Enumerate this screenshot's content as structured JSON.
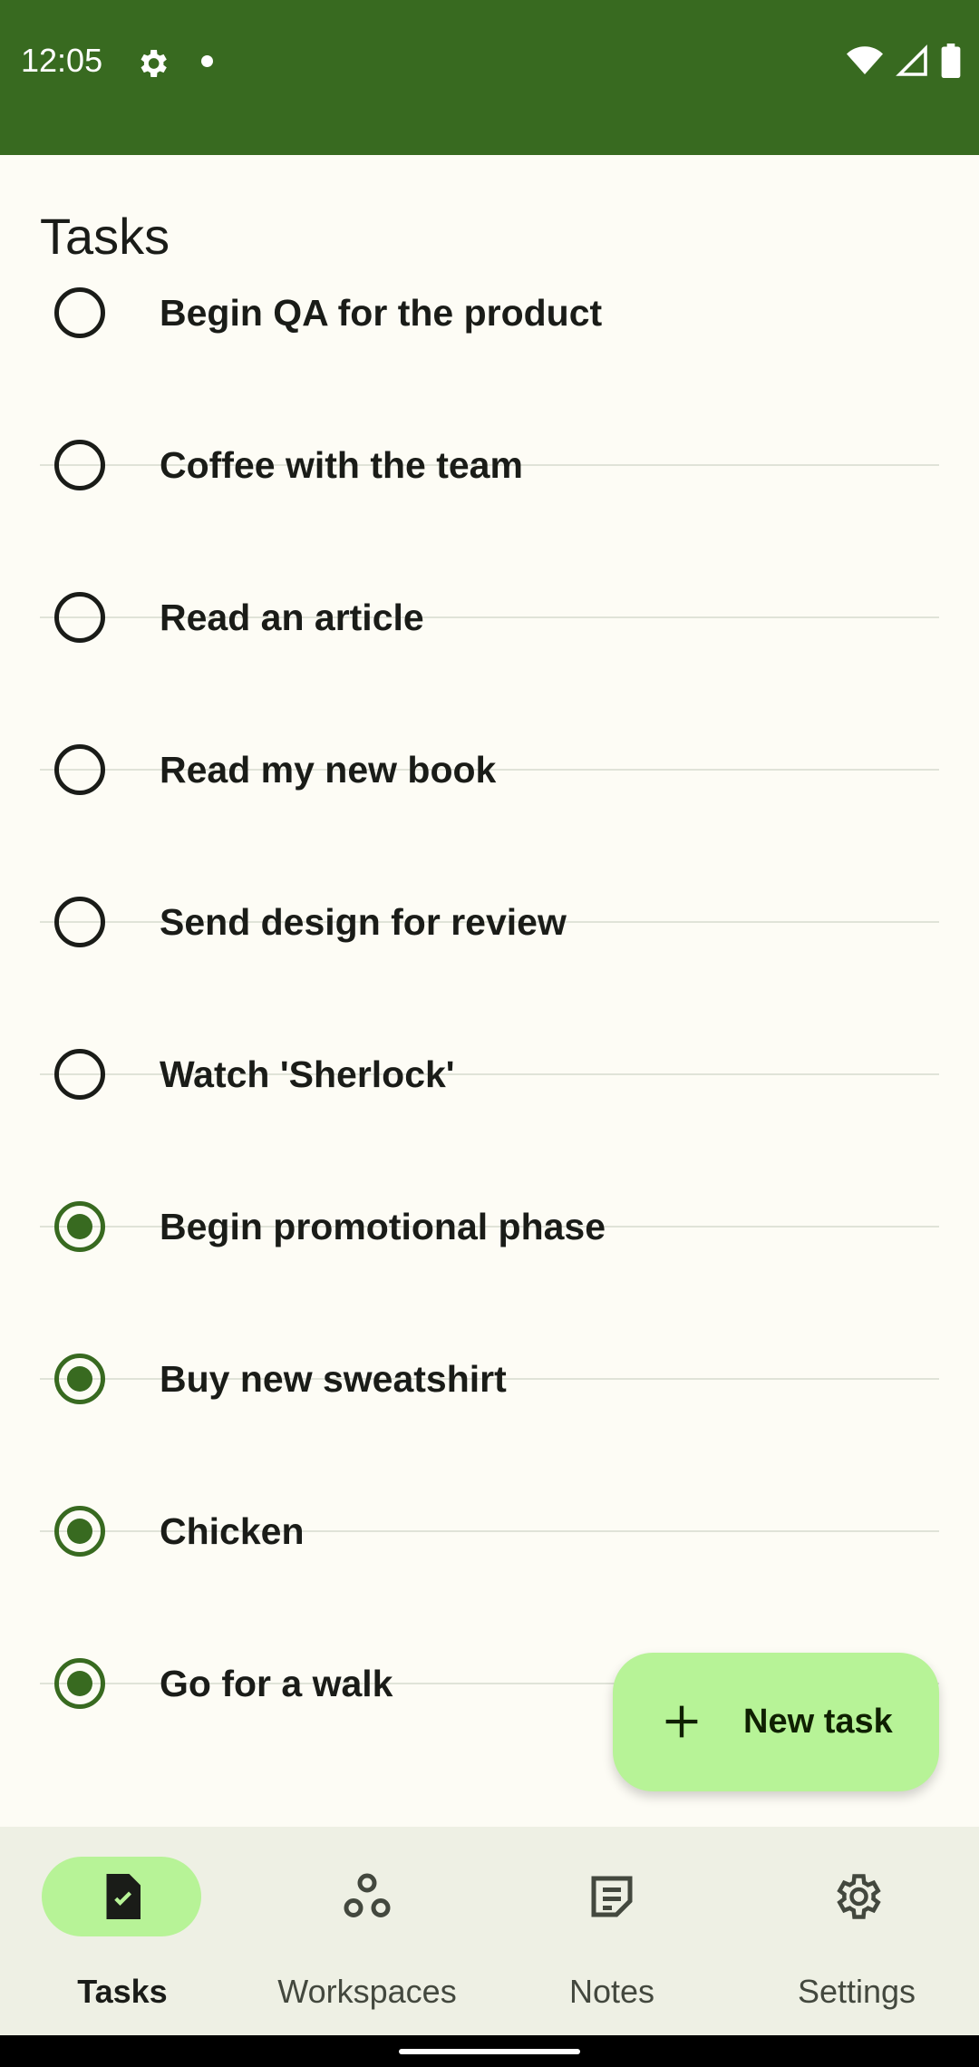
{
  "status_bar": {
    "time": "12:05",
    "icons": [
      "gear-icon",
      "notification-dot-icon",
      "wifi-icon",
      "signal-icon",
      "battery-icon"
    ]
  },
  "page": {
    "title": "Tasks"
  },
  "tasks": [
    {
      "label": "Begin QA for the product",
      "done": false
    },
    {
      "label": "Coffee with the team",
      "done": false
    },
    {
      "label": "Read an article",
      "done": false
    },
    {
      "label": "Read my new book",
      "done": false
    },
    {
      "label": "Send design for review",
      "done": false
    },
    {
      "label": "Watch 'Sherlock'",
      "done": false
    },
    {
      "label": "Begin promotional phase",
      "done": true
    },
    {
      "label": "Buy new sweatshirt",
      "done": true
    },
    {
      "label": "Chicken",
      "done": true
    },
    {
      "label": "Go for a walk",
      "done": true
    }
  ],
  "fab": {
    "label": "New task",
    "icon": "plus-icon"
  },
  "nav": {
    "items": [
      {
        "label": "Tasks",
        "icon": "task-check-icon",
        "active": true
      },
      {
        "label": "Workspaces",
        "icon": "workspaces-icon",
        "active": false
      },
      {
        "label": "Notes",
        "icon": "notes-icon",
        "active": false
      },
      {
        "label": "Settings",
        "icon": "gear-icon",
        "active": false
      }
    ]
  },
  "colors": {
    "primary": "#386a20",
    "primary_container": "#b7f397",
    "background": "#fdfcf5",
    "nav_background": "#eef0e4"
  }
}
